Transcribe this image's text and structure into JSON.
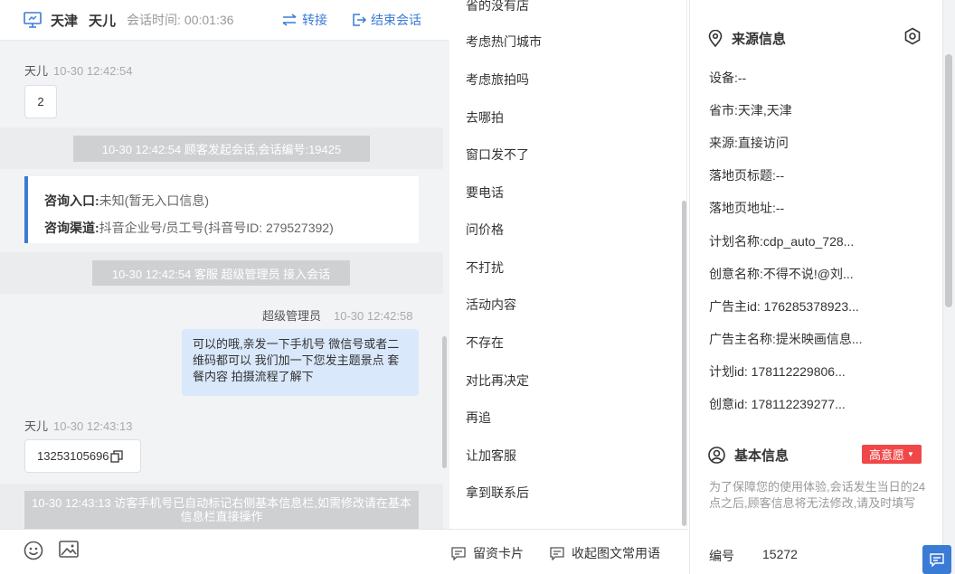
{
  "header": {
    "city": "天津",
    "visitor": "天儿",
    "session_label": "会话时间:",
    "session_time": "00:01:36",
    "transfer": "转接",
    "end_session": "结束会话"
  },
  "messages": {
    "m1_sender": "天儿",
    "m1_time": "10-30 12:42:54",
    "m1_text": "2",
    "sys1": "10-30 12:42:54 顾客发起会话,会话编号:19425",
    "card_entry_label": "咨询入口:",
    "card_entry_value": "未知(暂无入口信息)",
    "card_channel_label": "咨询渠道:",
    "card_channel_value": "抖音企业号/员工号(抖音号ID: 279527392)",
    "sys2": "10-30 12:42:54 客服 超级管理员 接入会话",
    "m2_sender": "超级管理员",
    "m2_time": "10-30 12:42:58",
    "m2_text": "可以的哦,亲发一下手机号 微信号或者二维码都可以 我们加一下您发主题景点 套餐内容 拍摄流程了解下",
    "m3_sender": "天儿",
    "m3_time": "10-30 12:43:13",
    "m3_text": "13253105696",
    "sys3": "10-30 12:43:13 访客手机号已自动标记右侧基本信息栏,如需修改请在基本信息栏直接操作"
  },
  "quick_replies": [
    "省的没有店",
    "考虑热门城市",
    "考虑旅拍吗",
    "去哪拍",
    "窗口发不了",
    "要电话",
    "问价格",
    "不打扰",
    "活动内容",
    "不存在",
    "对比再决定",
    "再追",
    "让加客服",
    "拿到联系后"
  ],
  "bottom": {
    "card_btn": "留资卡片",
    "collapse_btn": "收起图文常用语"
  },
  "source": {
    "title": "来源信息",
    "rows": [
      "设备:--",
      "省市:天津,天津",
      "来源:直接访问",
      "落地页标题:--",
      "落地页地址:--",
      "计划名称:cdp_auto_728...",
      "创意名称:不得不说!@刘...",
      "广告主id: 176285378923...",
      "广告主名称:提米映画信息...",
      "计划id: 178112229806...",
      "创意id: 178112239277..."
    ]
  },
  "basic": {
    "title": "基本信息",
    "badge": "高意愿",
    "note": "为了保障您的使用体验,会话发生当日的24点之后,顾客信息将无法修改,请及时填写",
    "id_label": "编号",
    "id_value": "15272"
  },
  "colors": {
    "accent": "#3a7bd5",
    "badge": "#f04848"
  }
}
